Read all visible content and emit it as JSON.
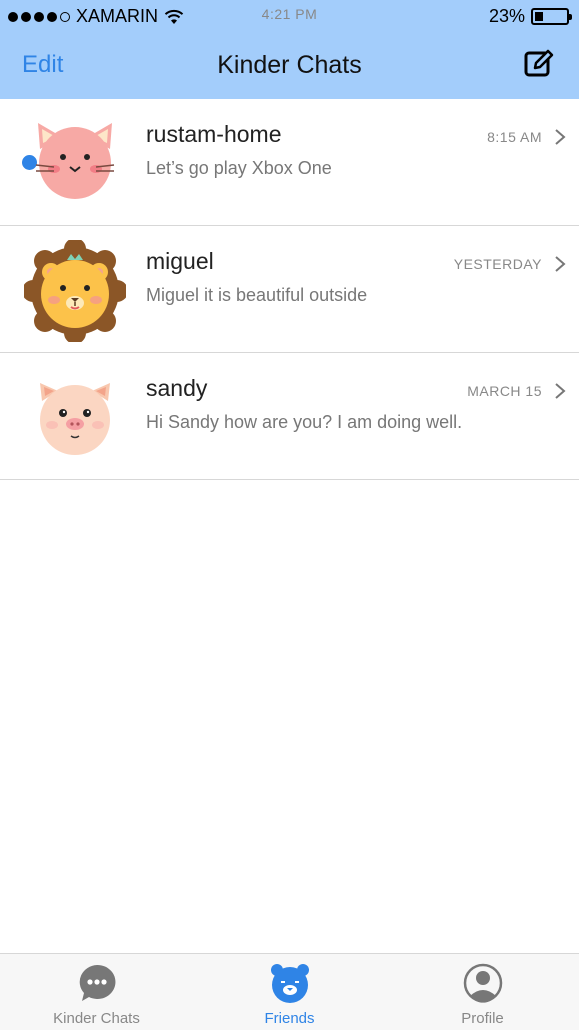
{
  "status_bar": {
    "carrier": "XAMARIN",
    "time": "4:21 PM",
    "battery_percent": "23%",
    "signal_dots_filled": 4,
    "signal_dots_total": 5
  },
  "nav": {
    "edit_label": "Edit",
    "title": "Kinder Chats",
    "compose_icon": "compose-icon"
  },
  "chats": [
    {
      "name": "rustam-home",
      "preview": "Let’s go play Xbox One",
      "time": "8:15 AM",
      "unread": true,
      "avatar": "cat-avatar"
    },
    {
      "name": "miguel",
      "preview": "Miguel it is beautiful outside",
      "time": "YESTERDAY",
      "unread": false,
      "avatar": "lion-avatar"
    },
    {
      "name": "sandy",
      "preview": "Hi Sandy how are you? I am doing well.",
      "time": "MARCH 15",
      "unread": false,
      "avatar": "pig-avatar"
    }
  ],
  "tabs": [
    {
      "label": "Kinder Chats",
      "icon": "chat-bubble-icon",
      "active": false
    },
    {
      "label": "Friends",
      "icon": "bear-icon",
      "active": true
    },
    {
      "label": "Profile",
      "icon": "person-icon",
      "active": false
    }
  ],
  "colors": {
    "header_bg": "#a3cdfb",
    "accent": "#2f84e6",
    "unread_dot": "#2f84e6",
    "inactive_tab": "#888888"
  }
}
